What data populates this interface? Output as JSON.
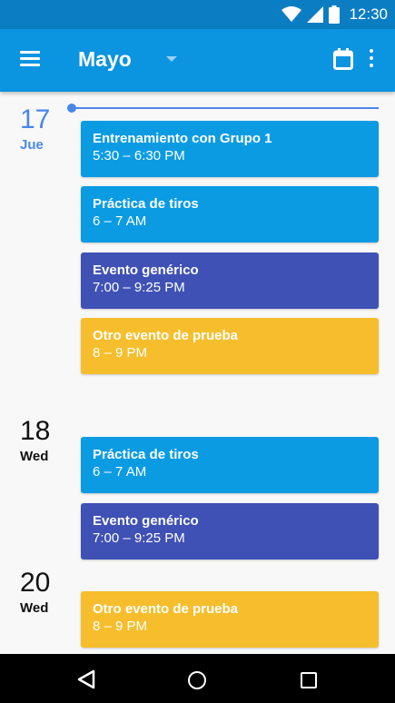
{
  "status_bar": {
    "time": "12:30"
  },
  "app_bar": {
    "title": "Mayo"
  },
  "colors": {
    "blue": "#0b9be3",
    "indigo": "#3f51b5",
    "amber": "#f6be2c",
    "today": "#4a86e8"
  },
  "days": [
    {
      "day": "17",
      "weekday": "Jue",
      "today": true,
      "events": [
        {
          "title": "Entrenamiento con Grupo 1",
          "time": "5:30 – 6:30 PM",
          "color": "blue"
        },
        {
          "title": "Práctica de tiros",
          "time": "6 – 7 AM",
          "color": "blue"
        },
        {
          "title": "Evento genérico",
          "time": "7:00 – 9:25 PM",
          "color": "indigo"
        },
        {
          "title": "Otro evento de prueba",
          "time": "8 – 9 PM",
          "color": "amber"
        }
      ]
    },
    {
      "day": "18",
      "weekday": "Wed",
      "today": false,
      "events": [
        {
          "title": "Práctica de tiros",
          "time": "6 – 7 AM",
          "color": "blue"
        },
        {
          "title": "Evento genérico",
          "time": "7:00 – 9:25 PM",
          "color": "indigo"
        }
      ]
    },
    {
      "day": "20",
      "weekday": "Wed",
      "today": false,
      "events": [
        {
          "title": "Otro evento de prueba",
          "time": "8 – 9 PM",
          "color": "amber"
        }
      ]
    }
  ]
}
